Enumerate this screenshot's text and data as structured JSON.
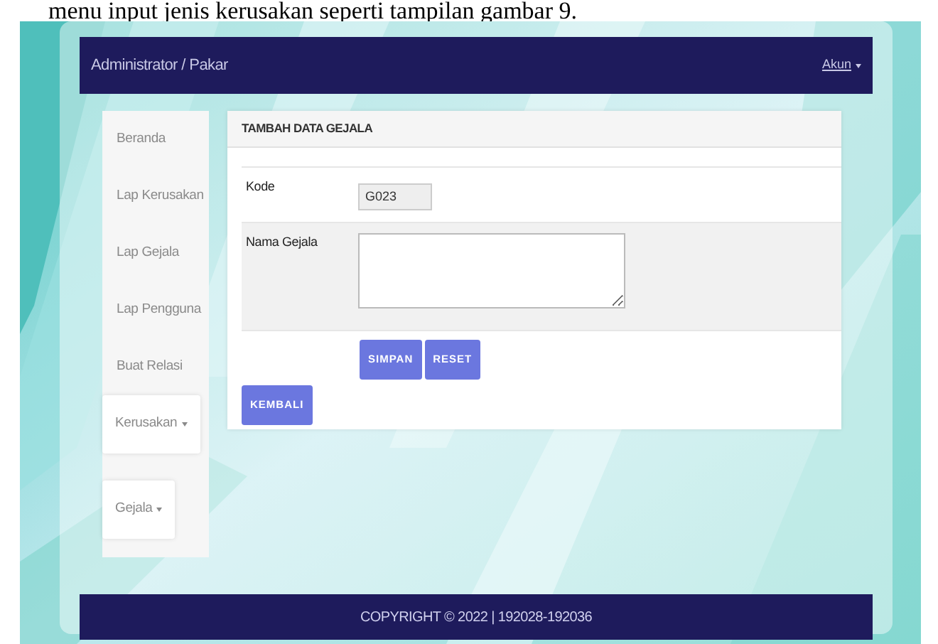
{
  "caption": "menu input jenis kerusakan seperti tampilan gambar 9.",
  "navbar": {
    "brand": "Administrator / Pakar",
    "account": "Akun"
  },
  "sidebar": {
    "items": [
      {
        "label": "Beranda",
        "kind": "link"
      },
      {
        "label": "Lap Kerusakan",
        "kind": "link"
      },
      {
        "label": "Lap Gejala",
        "kind": "link"
      },
      {
        "label": "Lap Pengguna",
        "kind": "link"
      },
      {
        "label": "Buat Relasi",
        "kind": "link"
      },
      {
        "label": "Kerusakan",
        "kind": "dropdown"
      },
      {
        "label": "Gejala",
        "kind": "dropdown"
      }
    ]
  },
  "panel": {
    "title": "TAMBAH DATA GEJALA",
    "fields": [
      {
        "label": "Kode",
        "kind": "input",
        "value": "G023"
      },
      {
        "label": "Nama Gejala",
        "kind": "textarea"
      }
    ],
    "buttons": [
      "SIMPAN",
      "RESET"
    ],
    "back_button": "KEMBALI"
  },
  "footer": "COPYRIGHT © 2022 | 192028-192036"
}
